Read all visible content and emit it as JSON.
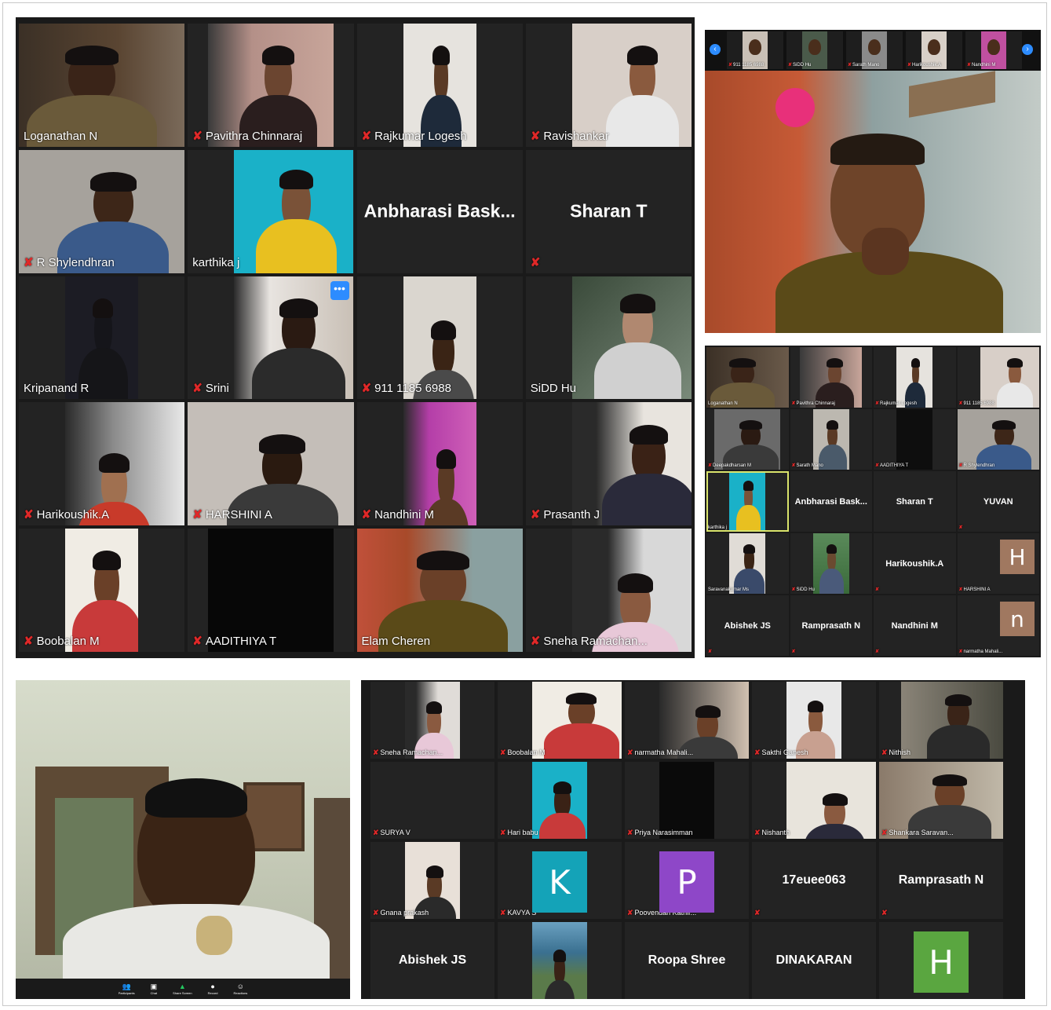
{
  "gallery_main": {
    "tiles": [
      {
        "name": "Loganathan N",
        "muted": false
      },
      {
        "name": "Pavithra Chinnaraj",
        "muted": true
      },
      {
        "name": "Rajkumar Logesh",
        "muted": true
      },
      {
        "name": "Ravishankar",
        "muted": true
      },
      {
        "name": "R Shylendhran",
        "muted": true
      },
      {
        "name": "karthika j",
        "muted": false
      },
      {
        "name": "Anbharasi  Bask...",
        "muted": false
      },
      {
        "name": "Sharan T",
        "muted": true
      },
      {
        "name": "Kripanand R",
        "muted": false
      },
      {
        "name": "Srini",
        "muted": true
      },
      {
        "name": "911 1185 6988",
        "muted": true
      },
      {
        "name": "SiDD Hu",
        "muted": false
      },
      {
        "name": "Harikoushik.A",
        "muted": true
      },
      {
        "name": "HARSHINI A",
        "muted": true
      },
      {
        "name": "Nandhini M",
        "muted": true
      },
      {
        "name": "Prasanth J",
        "muted": true
      },
      {
        "name": "Boobalan M",
        "muted": true
      },
      {
        "name": "AADITHIYA T",
        "muted": true
      },
      {
        "name": "Elam Cheren",
        "muted": false
      },
      {
        "name": "Sneha Ramachan...",
        "muted": true
      }
    ],
    "more_button": "•••"
  },
  "speaker_view": {
    "strip": [
      "911 1185 6988",
      "SiDD Hu",
      "Sarath Mano",
      "Harikoushik.A",
      "Nandhini M"
    ]
  },
  "gallery_small": {
    "tiles": [
      {
        "name": "Loganathan N",
        "muted": false
      },
      {
        "name": "Pavithra Chinnaraj",
        "muted": true
      },
      {
        "name": "Rajkumar Logesh",
        "muted": true
      },
      {
        "name": "911 1185 6988",
        "muted": true
      },
      {
        "name": "Deepakdharsan M",
        "muted": true
      },
      {
        "name": "Sarath Mano",
        "muted": true
      },
      {
        "name": "AADITHIYA T",
        "muted": true
      },
      {
        "name": "R Shylendhran",
        "muted": true
      },
      {
        "name": "karthika j",
        "muted": false
      },
      {
        "name": "Anbharasi  Bask...",
        "muted": false
      },
      {
        "name": "Sharan T",
        "muted": false
      },
      {
        "name": "YUVAN",
        "muted": true
      },
      {
        "name": "Saravanakumar Ms",
        "muted": false
      },
      {
        "name": "SiDD Hu",
        "muted": true
      },
      {
        "name": "Harikoushik.A",
        "muted": true
      },
      {
        "name": "HARSHINI A",
        "muted": true
      },
      {
        "name": "Abishek JS",
        "muted": true
      },
      {
        "name": "Ramprasath N",
        "muted": true
      },
      {
        "name": "Nandhini M",
        "muted": true
      },
      {
        "name": "narmatha Mahali...",
        "muted": true
      }
    ],
    "letters": [
      "H",
      "n"
    ]
  },
  "host_view": {
    "toolbar": [
      "Participants",
      "Chat",
      "Share Screen",
      "Record",
      "Reactions"
    ]
  },
  "gallery_bottom": {
    "tiles": [
      {
        "name": "Sneha Ramachan...",
        "muted": true
      },
      {
        "name": "Boobalan M",
        "muted": true
      },
      {
        "name": "narmatha Mahali...",
        "muted": true
      },
      {
        "name": "Sakthi Ganesh",
        "muted": true
      },
      {
        "name": "Nithish",
        "muted": true
      },
      {
        "name": "SURYA V",
        "muted": true
      },
      {
        "name": "Hari babu",
        "muted": true
      },
      {
        "name": "Priya Narasimman",
        "muted": true
      },
      {
        "name": "Nishanth",
        "muted": true
      },
      {
        "name": "Shankara Saravan...",
        "muted": true
      },
      {
        "name": "Gnana prakash",
        "muted": true
      },
      {
        "name": "KAVYA S",
        "muted": true
      },
      {
        "name": "Poovendan Kathir...",
        "muted": true
      },
      {
        "name": "17euee063",
        "muted": true
      },
      {
        "name": "Ramprasath N",
        "muted": true
      },
      {
        "name": "Abishek JS",
        "muted": false
      },
      {
        "name": "",
        "muted": false
      },
      {
        "name": "Roopa Shree",
        "muted": false
      },
      {
        "name": "DINAKARAN",
        "muted": false
      },
      {
        "name": "",
        "muted": false
      }
    ],
    "letters": [
      "K",
      "P",
      "H"
    ]
  },
  "colors": {
    "panel_bg": "#1a1a1a",
    "tile_bg": "#232323",
    "mute_red": "#e02828",
    "zoom_blue": "#2d8cff",
    "avatar_teal": "#14a3b8",
    "avatar_purple": "#8e47c8",
    "avatar_green": "#5aa640",
    "avatar_brown": "#a07860"
  }
}
